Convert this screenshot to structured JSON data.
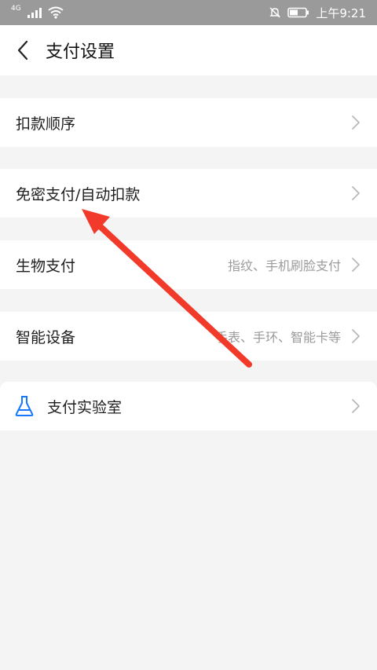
{
  "status_bar": {
    "network": "4G",
    "time": "上午9:21"
  },
  "header": {
    "title": "支付设置"
  },
  "rows": [
    {
      "label": "扣款顺序",
      "sub": ""
    },
    {
      "label": "免密支付/自动扣款",
      "sub": ""
    },
    {
      "label": "生物支付",
      "sub": "指纹、手机刷脸支付"
    },
    {
      "label": "智能设备",
      "sub": "手表、手环、智能卡等"
    }
  ],
  "lab": {
    "label": "支付实验室",
    "icon": "flask-icon"
  },
  "colors": {
    "accent_blue": "#1677ff",
    "annotation_red": "#f23a2a",
    "status_bar": "#9a9a9a"
  }
}
